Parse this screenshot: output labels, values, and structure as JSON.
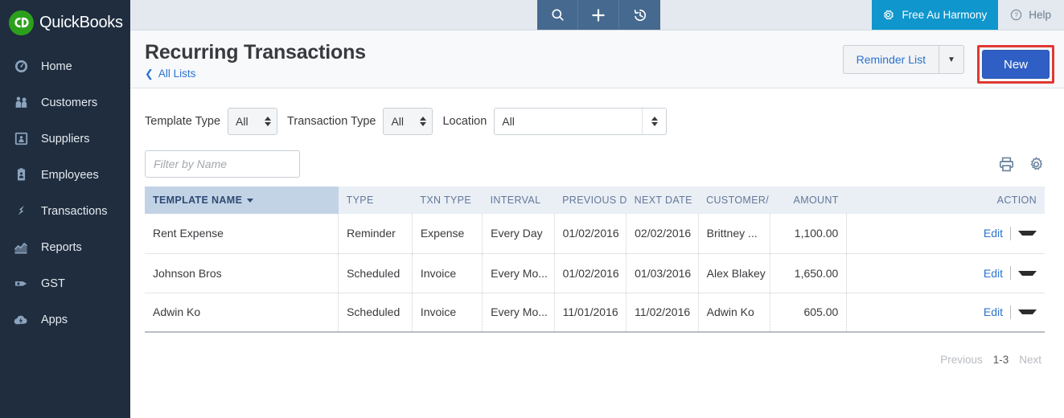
{
  "brand": {
    "logo_text": "QuickBooks",
    "logo_mark": "qb-logo-icon",
    "logo_color": "#2ca01c"
  },
  "sidebar": {
    "items": [
      {
        "label": "Home",
        "icon": "gauge-icon"
      },
      {
        "label": "Customers",
        "icon": "people-icon"
      },
      {
        "label": "Suppliers",
        "icon": "supplier-card-icon"
      },
      {
        "label": "Employees",
        "icon": "employee-badge-icon"
      },
      {
        "label": "Transactions",
        "icon": "transactions-icon"
      },
      {
        "label": "Reports",
        "icon": "chart-line-icon"
      },
      {
        "label": "GST",
        "icon": "gst-tag-icon"
      },
      {
        "label": "Apps",
        "icon": "apps-cloud-icon"
      }
    ]
  },
  "topbar": {
    "icons": [
      {
        "name": "search-icon"
      },
      {
        "name": "plus-icon"
      },
      {
        "name": "recent-history-icon"
      }
    ],
    "company_label": "Free Au Harmony",
    "company_icon": "gear-icon",
    "company_color": "#0e96cd",
    "help_label": "Help",
    "help_icon": "question-circle-icon"
  },
  "page": {
    "title": "Recurring Transactions",
    "back_label": "All Lists",
    "back_icon": "chevron-left-icon",
    "reminder_label": "Reminder List",
    "reminder_caret_icon": "chevron-down-icon",
    "new_label": "New",
    "new_color": "#2f5fc4",
    "highlight_color": "#e03a33"
  },
  "filters": {
    "template_type": {
      "label": "Template Type",
      "value": "All"
    },
    "transaction_type": {
      "label": "Transaction Type",
      "value": "All"
    },
    "location": {
      "label": "Location",
      "value": "All"
    },
    "name_filter": {
      "value": "",
      "placeholder": "Filter by Name"
    },
    "print_icon": "printer-icon",
    "settings_icon": "gear-icon"
  },
  "table": {
    "columns": [
      {
        "key": "name",
        "label": "TEMPLATE NAME",
        "sorted": true,
        "align": "left"
      },
      {
        "key": "type",
        "label": "TYPE",
        "align": "left"
      },
      {
        "key": "txn_type",
        "label": "TXN TYPE",
        "align": "left"
      },
      {
        "key": "interval",
        "label": "INTERVAL",
        "align": "left"
      },
      {
        "key": "previous_date",
        "label": "PREVIOUS D",
        "align": "left"
      },
      {
        "key": "next_date",
        "label": "NEXT DATE",
        "align": "left"
      },
      {
        "key": "customer",
        "label": "CUSTOMER/",
        "align": "left"
      },
      {
        "key": "amount",
        "label": "AMOUNT",
        "align": "right"
      },
      {
        "key": "action",
        "label": "ACTION",
        "align": "right"
      }
    ],
    "rows": [
      {
        "name": "Rent Expense",
        "type": "Reminder",
        "txn_type": "Expense",
        "interval": "Every Day",
        "previous_date": "01/02/2016",
        "next_date": "02/02/2016",
        "customer": "Brittney ...",
        "amount": "1,100.00",
        "action": "Edit"
      },
      {
        "name": "Johnson Bros",
        "type": "Scheduled",
        "txn_type": "Invoice",
        "interval": "Every Mo...",
        "previous_date": "01/02/2016",
        "next_date": "01/03/2016",
        "customer": "Alex Blakey",
        "amount": "1,650.00",
        "action": "Edit"
      },
      {
        "name": "Adwin Ko",
        "type": "Scheduled",
        "txn_type": "Invoice",
        "interval": "Every Mo...",
        "previous_date": "11/01/2016",
        "next_date": "11/02/2016",
        "customer": "Adwin Ko",
        "amount": "605.00",
        "action": "Edit"
      }
    ]
  },
  "pagination": {
    "previous_label": "Previous",
    "range_label": "1-3",
    "next_label": "Next"
  }
}
